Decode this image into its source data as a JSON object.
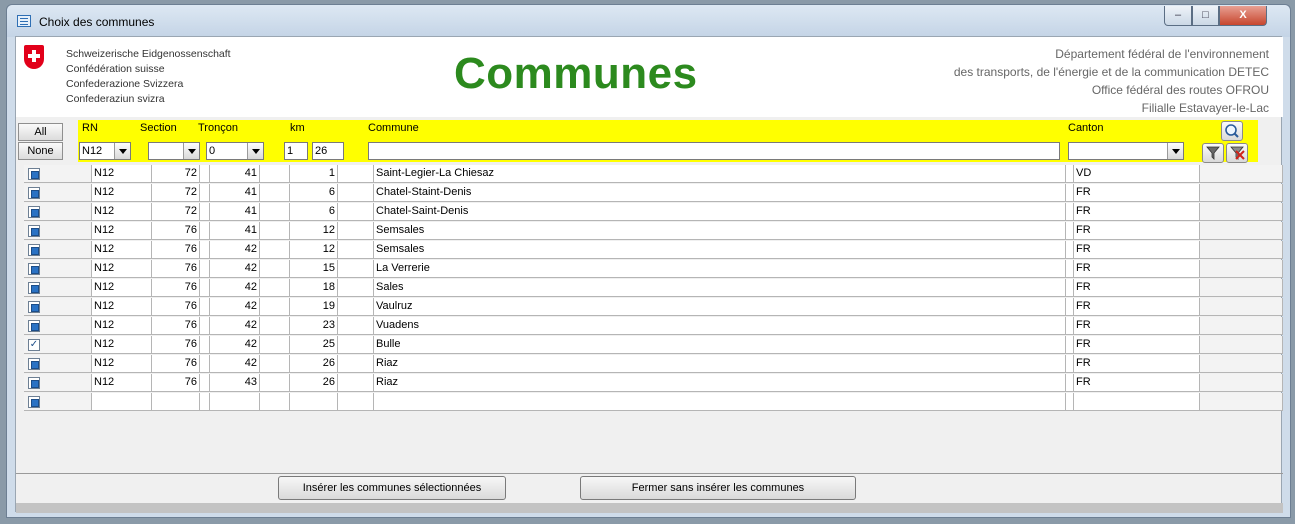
{
  "window": {
    "title": "Choix des communes",
    "minimize": "–",
    "maximize": "□",
    "close": "X"
  },
  "header": {
    "confederation": [
      "Schweizerische Eidgenossenschaft",
      "Confédération suisse",
      "Confederazione Svizzera",
      "Confederaziun svizra"
    ],
    "title": "Communes",
    "department": [
      "Département fédéral de l'environnement",
      "des transports, de l'énergie et de la communication DETEC",
      "Office fédéral des routes OFROU",
      "Filialle Estavayer-le-Lac"
    ]
  },
  "select": {
    "all": "All",
    "none": "None"
  },
  "columns": {
    "rn": "RN",
    "section": "Section",
    "troncon": "Tronçon",
    "km": "km",
    "commune": "Commune",
    "canton": "Canton"
  },
  "filters": {
    "rn": "N12",
    "section": "",
    "troncon": "0",
    "km_from": "1",
    "km_to": "26",
    "commune": "",
    "canton": ""
  },
  "icons": {
    "search": "search-icon",
    "filter": "filter-icon",
    "clear_filter": "clear-filter-icon"
  },
  "rows": [
    {
      "selected": false,
      "rn": "N12",
      "section": "72",
      "troncon": "41",
      "km": "1",
      "commune": "Saint-Legier-La Chiesaz",
      "canton": "VD"
    },
    {
      "selected": false,
      "rn": "N12",
      "section": "72",
      "troncon": "41",
      "km": "6",
      "commune": "Chatel-Staint-Denis",
      "canton": "FR"
    },
    {
      "selected": false,
      "rn": "N12",
      "section": "72",
      "troncon": "41",
      "km": "6",
      "commune": "Chatel-Saint-Denis",
      "canton": "FR"
    },
    {
      "selected": false,
      "rn": "N12",
      "section": "76",
      "troncon": "41",
      "km": "12",
      "commune": "Semsales",
      "canton": "FR"
    },
    {
      "selected": false,
      "rn": "N12",
      "section": "76",
      "troncon": "42",
      "km": "12",
      "commune": "Semsales",
      "canton": "FR"
    },
    {
      "selected": false,
      "rn": "N12",
      "section": "76",
      "troncon": "42",
      "km": "15",
      "commune": "La Verrerie",
      "canton": "FR"
    },
    {
      "selected": false,
      "rn": "N12",
      "section": "76",
      "troncon": "42",
      "km": "18",
      "commune": "Sales",
      "canton": "FR"
    },
    {
      "selected": false,
      "rn": "N12",
      "section": "76",
      "troncon": "42",
      "km": "19",
      "commune": "Vaulruz",
      "canton": "FR"
    },
    {
      "selected": false,
      "rn": "N12",
      "section": "76",
      "troncon": "42",
      "km": "23",
      "commune": "Vuadens",
      "canton": "FR"
    },
    {
      "selected": true,
      "rn": "N12",
      "section": "76",
      "troncon": "42",
      "km": "25",
      "commune": "Bulle",
      "canton": "FR"
    },
    {
      "selected": false,
      "rn": "N12",
      "section": "76",
      "troncon": "42",
      "km": "26",
      "commune": "Riaz",
      "canton": "FR"
    },
    {
      "selected": false,
      "rn": "N12",
      "section": "76",
      "troncon": "43",
      "km": "26",
      "commune": "Riaz",
      "canton": "FR"
    },
    {
      "selected": false,
      "rn": "",
      "section": "",
      "troncon": "",
      "km": "",
      "commune": "",
      "canton": ""
    }
  ],
  "buttons": {
    "insert": "Insérer les communes sélectionnées",
    "close": "Fermer sans insérer les communes"
  }
}
